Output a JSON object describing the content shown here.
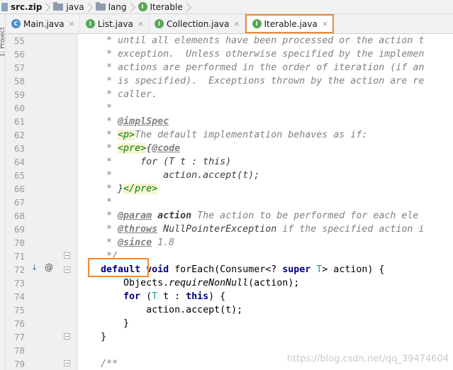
{
  "breadcrumb": [
    {
      "label": "src.zip",
      "icon": "zip-icon",
      "bold": true
    },
    {
      "label": "java",
      "icon": "folder-icon"
    },
    {
      "label": "lang",
      "icon": "folder-icon"
    },
    {
      "label": "Iterable",
      "icon": "interface-icon"
    }
  ],
  "left_tool_label": "1: Project",
  "tabs": [
    {
      "label": "Main.java",
      "icon": "class-icon",
      "glyph": "C",
      "active": false
    },
    {
      "label": "List.java",
      "icon": "interface-icon",
      "glyph": "I",
      "active": false
    },
    {
      "label": "Collection.java",
      "icon": "interface-icon",
      "glyph": "I",
      "active": false
    },
    {
      "label": "Iterable.java",
      "icon": "interface-icon",
      "glyph": "I",
      "active": true
    }
  ],
  "close_glyph": "×",
  "code": {
    "line_numbers": [
      "55",
      "56",
      "57",
      "58",
      "59",
      "60",
      "61",
      "62",
      "63",
      "64",
      "65",
      "66",
      "67",
      "68",
      "69",
      "70",
      "71",
      "72",
      "73",
      "74",
      "75",
      "76",
      "77",
      "78",
      "79"
    ],
    "l55": {
      "pre": "     * ",
      "text": "until all elements have been processed or the action t"
    },
    "l56": {
      "pre": "     * ",
      "text": "exception.  Unless otherwise specified by the implemen"
    },
    "l57": {
      "pre": "     * ",
      "text": "actions are performed in the order of iteration (if an"
    },
    "l58": {
      "pre": "     * ",
      "text": "is specified).  Exceptions thrown by the action are re"
    },
    "l59": {
      "pre": "     * ",
      "text": "caller."
    },
    "l60": {
      "pre": "     *",
      "text": ""
    },
    "l61": {
      "pre": "     * ",
      "tag": "@implSpec"
    },
    "l62": {
      "pre": "     * ",
      "html": "<p>",
      "text": "The default implementation behaves as if:"
    },
    "l63": {
      "pre": "     * ",
      "html": "<pre>",
      "brace": "{",
      "tag": "@code"
    },
    "l64": {
      "pre": "     *     ",
      "text": "for (T t : this)"
    },
    "l65": {
      "pre": "     *         ",
      "text": "action.accept(t);"
    },
    "l66": {
      "pre": "     * ",
      "brace": "}",
      "html": "</pre>"
    },
    "l67": {
      "pre": "     *",
      "text": ""
    },
    "l68": {
      "pre": "     * ",
      "tag": "@param",
      "name": "action",
      "text": " The action to be performed for each ele"
    },
    "l69": {
      "pre": "     * ",
      "tag": "@throws",
      "name": "NullPointerException",
      "text": " if the specified action i"
    },
    "l70": {
      "pre": "     * ",
      "tag": "@since",
      "text": " 1.8"
    },
    "l71": {
      "text": "     */"
    },
    "l72": {
      "indent": "    ",
      "kw_default": "default",
      "kw_void": "void",
      "signature": " forEach(Consumer<? ",
      "kw_super": "super",
      "type_param": "T",
      "tail": "> action) {"
    },
    "l73": {
      "indent": "        ",
      "obj": "Objects.",
      "method": "requireNonNull",
      "tail": "(action);"
    },
    "l74": {
      "indent": "        ",
      "kw_for": "for",
      "open": " (",
      "type_param": "T",
      "mid": " t : ",
      "kw_this": "this",
      "tail": ") {"
    },
    "l75": {
      "indent": "            ",
      "text": "action.accept(t);"
    },
    "l76": {
      "indent": "        ",
      "text": "}"
    },
    "l77": {
      "indent": "    ",
      "text": "}"
    },
    "l78": {
      "text": ""
    },
    "l79": {
      "indent": "    ",
      "text": "/**"
    }
  },
  "gutter_icons": {
    "line72_override": "↓",
    "line72_annotation": "@"
  },
  "watermark": "https://blog.csdn.net/qq_39474604",
  "colors": {
    "accent_highlight": "#f08a32",
    "keyword": "#000080",
    "doc_comment": "#808080",
    "html_tag": "#008000",
    "type_param": "#20999d"
  }
}
